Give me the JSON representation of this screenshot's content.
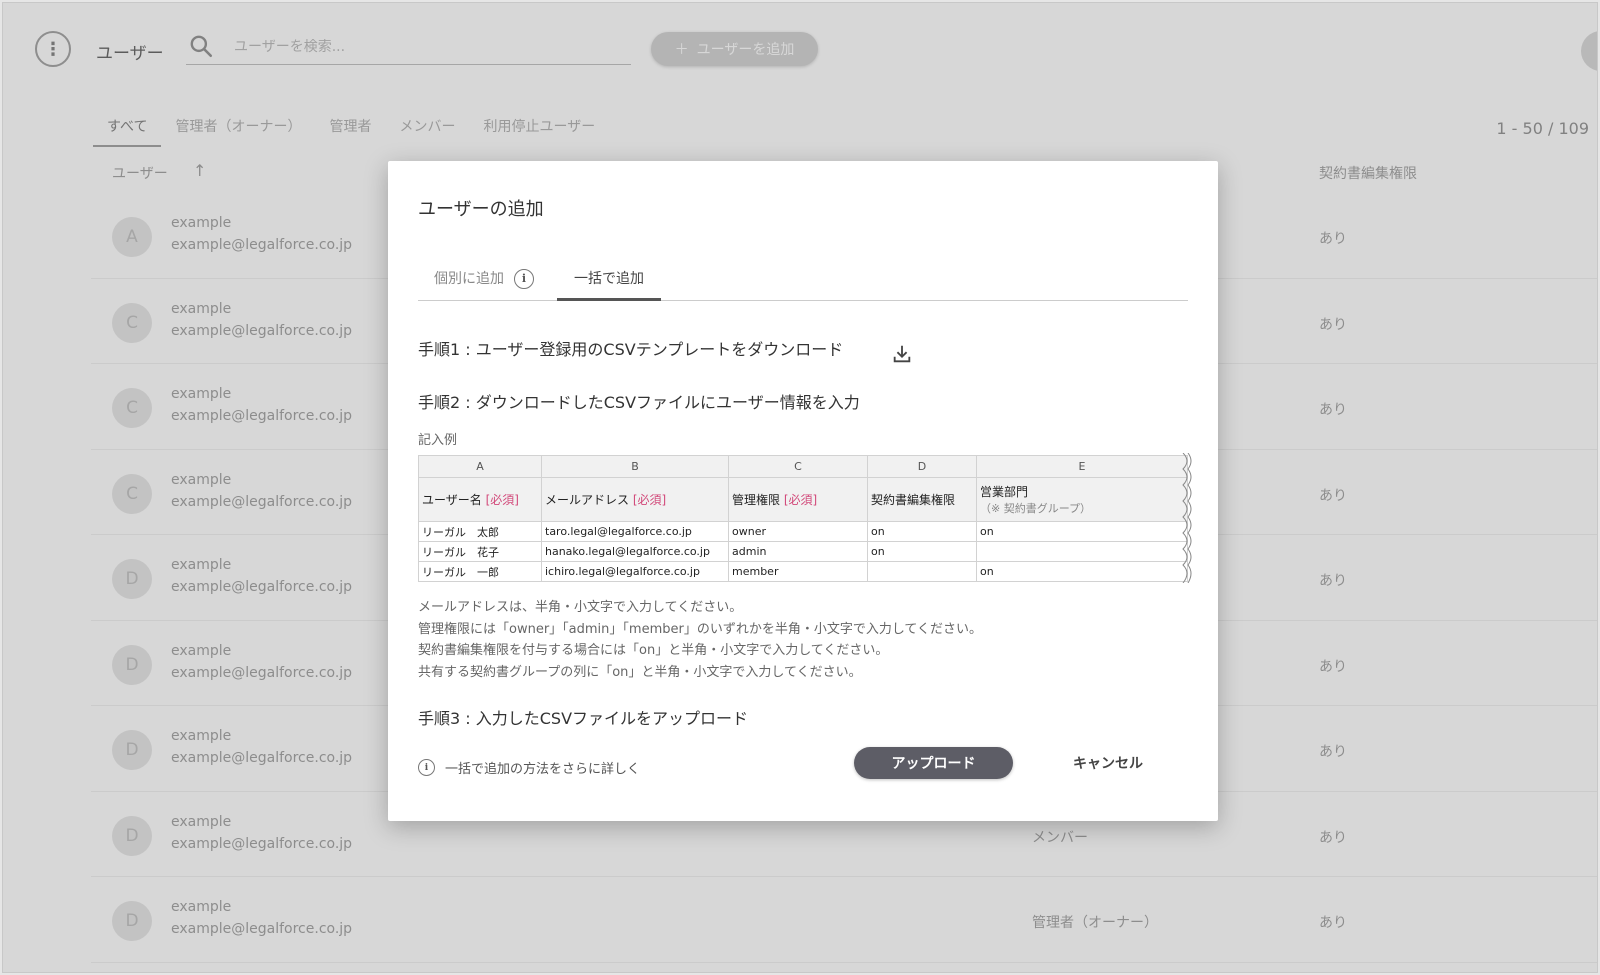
{
  "header": {
    "title": "ユーザー",
    "search_placeholder": "ユーザーを検索...",
    "add_user_label": "ユーザーを追加",
    "menu_glyph": "⋮"
  },
  "filter_tabs": [
    "すべて",
    "管理者（オーナー）",
    "管理者",
    "メンバー",
    "利用停止ユーザー"
  ],
  "count_label": "1 - 50 / 109",
  "columns": {
    "user": "ユーザー",
    "sort_glyph": "↑",
    "contract_edit": "契約書編集権限"
  },
  "users": [
    {
      "initial": "A",
      "name": "example",
      "email": "example@legalforce.co.jp",
      "role": "",
      "contract_edit": "あり"
    },
    {
      "initial": "C",
      "name": "example",
      "email": "example@legalforce.co.jp",
      "role": "",
      "contract_edit": "あり"
    },
    {
      "initial": "C",
      "name": "example",
      "email": "example@legalforce.co.jp",
      "role": "",
      "contract_edit": "あり"
    },
    {
      "initial": "C",
      "name": "example",
      "email": "example@legalforce.co.jp",
      "role": "",
      "contract_edit": "あり"
    },
    {
      "initial": "D",
      "name": "example",
      "email": "example@legalforce.co.jp",
      "role": "",
      "contract_edit": "あり"
    },
    {
      "initial": "D",
      "name": "example",
      "email": "example@legalforce.co.jp",
      "role": "",
      "contract_edit": "あり"
    },
    {
      "initial": "D",
      "name": "example",
      "email": "example@legalforce.co.jp",
      "role": "",
      "contract_edit": "あり"
    },
    {
      "initial": "D",
      "name": "example",
      "email": "example@legalforce.co.jp",
      "role": "メンバー",
      "contract_edit": "あり"
    },
    {
      "initial": "D",
      "name": "example",
      "email": "example@legalforce.co.jp",
      "role": "管理者（オーナー）",
      "contract_edit": "あり"
    }
  ],
  "modal": {
    "title": "ユーザーの追加",
    "tab_individual": "個別に追加",
    "tab_bulk": "一括で追加",
    "step1": "手順1 : ユーザー登録用のCSVテンプレートをダウンロード",
    "step2": "手順2 : ダウンロードしたCSVファイルにユーザー情報を入力",
    "example_label": "記入例",
    "sheet": {
      "column_letters": [
        "A",
        "B",
        "C",
        "D",
        "E"
      ],
      "headers": {
        "user_name": "ユーザー名",
        "email": "メールアドレス",
        "admin": "管理権限",
        "required": "[必須]",
        "contract_edit": "契約書編集権限",
        "dept": "営業部門",
        "dept_note": "（※ 契約書グループ）"
      },
      "rows": [
        [
          "リーガル　太郎",
          "taro.legal@legalforce.co.jp",
          "owner",
          "on",
          "on"
        ],
        [
          "リーガル　花子",
          "hanako.legal@legalforce.co.jp",
          "admin",
          "on",
          ""
        ],
        [
          "リーガル　一郎",
          "ichiro.legal@legalforce.co.jp",
          "member",
          "",
          "on"
        ]
      ]
    },
    "notes": [
      "メールアドレスは、半角・小文字で入力してください。",
      "管理権限には「owner」「admin」「member」のいずれかを半角・小文字で入力してください。",
      "契約書編集権限を付与する場合には「on」と半角・小文字で入力してください。",
      "共有する契約書グループの列に「on」と半角・小文字で入力してください。"
    ],
    "step3": "手順3 : 入力したCSVファイルをアップロード",
    "learn_more": "一括で追加の方法をさらに詳しく",
    "upload_label": "アップロード",
    "cancel_label": "キャンセル",
    "info_glyph": "i"
  },
  "colors": {
    "primary_button": "#5d5d66",
    "required_text": "#d2497a",
    "overlay": "rgba(110,110,110,0.28)"
  }
}
